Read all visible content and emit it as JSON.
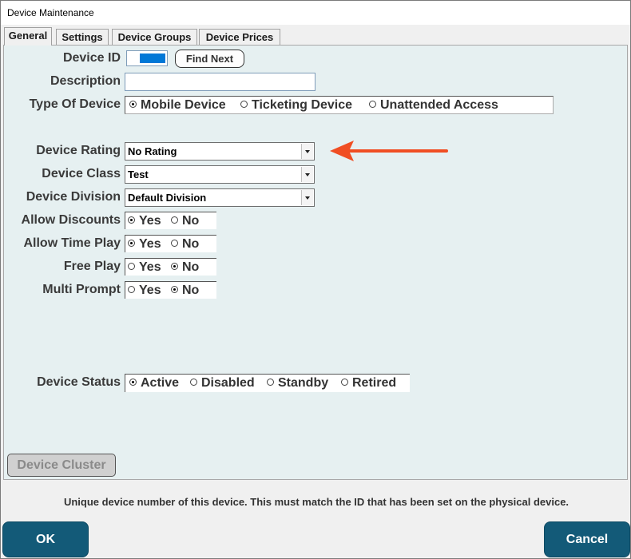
{
  "window": {
    "title": "Device Maintenance"
  },
  "tabs": [
    {
      "label": "General",
      "active": true
    },
    {
      "label": "Settings",
      "active": false
    },
    {
      "label": "Device Groups",
      "active": false
    },
    {
      "label": "Device Prices",
      "active": false
    }
  ],
  "form": {
    "device_id": {
      "label": "Device ID",
      "value": ""
    },
    "find_next_label": "Find Next",
    "description": {
      "label": "Description",
      "value": ""
    },
    "type_of_device": {
      "label": "Type Of Device",
      "options": [
        "Mobile Device",
        "Ticketing Device",
        "Unattended Access"
      ],
      "selected": "Mobile Device"
    },
    "device_rating": {
      "label": "Device Rating",
      "value": "No Rating"
    },
    "device_class": {
      "label": "Device Class",
      "value": "Test"
    },
    "device_division": {
      "label": "Device Division",
      "value": "Default Division"
    },
    "allow_discounts": {
      "label": "Allow Discounts",
      "options": [
        "Yes",
        "No"
      ],
      "selected": "Yes"
    },
    "allow_time_play": {
      "label": "Allow Time Play",
      "options": [
        "Yes",
        "No"
      ],
      "selected": "Yes"
    },
    "free_play": {
      "label": "Free Play",
      "options": [
        "Yes",
        "No"
      ],
      "selected": "No"
    },
    "multi_prompt": {
      "label": "Multi Prompt",
      "options": [
        "Yes",
        "No"
      ],
      "selected": "No"
    },
    "device_status": {
      "label": "Device Status",
      "options": [
        "Active",
        "Disabled",
        "Standby",
        "Retired"
      ],
      "selected": "Active"
    }
  },
  "device_cluster_label": "Device Cluster",
  "hint_text": "Unique device number of this device.  This must match the ID that has been set on the physical device.",
  "buttons": {
    "ok": "OK",
    "cancel": "Cancel"
  },
  "colors": {
    "accent_button": "#135a78",
    "annotation_arrow": "#f04e23",
    "panel_bg": "#e6f0f1"
  }
}
